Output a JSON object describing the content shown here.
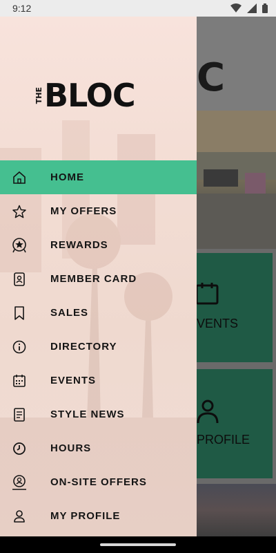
{
  "status_bar": {
    "time": "9:12"
  },
  "brand": {
    "prefix": "THE",
    "name": "BLOC"
  },
  "background": {
    "tile_events": "VENTS",
    "tile_profile": "PROFILE"
  },
  "menu": {
    "items": [
      {
        "label": "HOME",
        "icon": "home-icon",
        "active": true
      },
      {
        "label": "MY OFFERS",
        "icon": "star-icon",
        "active": false
      },
      {
        "label": "REWARDS",
        "icon": "rewards-badge-icon",
        "active": false
      },
      {
        "label": "MEMBER CARD",
        "icon": "member-card-icon",
        "active": false
      },
      {
        "label": "SALES",
        "icon": "bookmark-icon",
        "active": false
      },
      {
        "label": "DIRECTORY",
        "icon": "info-icon",
        "active": false
      },
      {
        "label": "EVENTS",
        "icon": "calendar-icon",
        "active": false
      },
      {
        "label": "STYLE NEWS",
        "icon": "article-icon",
        "active": false
      },
      {
        "label": "HOURS",
        "icon": "clock-icon",
        "active": false
      },
      {
        "label": "ON-SITE OFFERS",
        "icon": "onsite-offer-icon",
        "active": false
      },
      {
        "label": "MY PROFILE",
        "icon": "person-icon",
        "active": false
      }
    ]
  },
  "colors": {
    "active_item": "#45bf90",
    "tile": "#1f5a45"
  }
}
